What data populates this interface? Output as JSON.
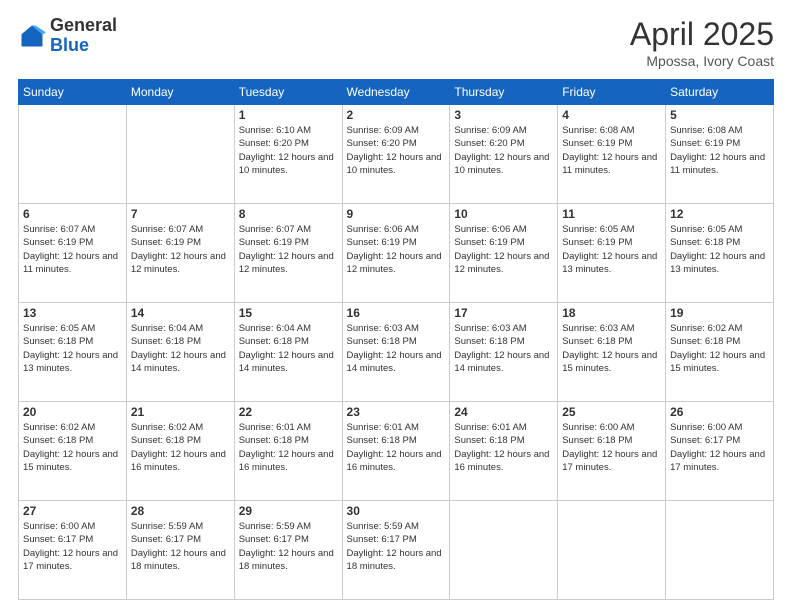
{
  "logo": {
    "general": "General",
    "blue": "Blue"
  },
  "title": {
    "month_year": "April 2025",
    "location": "Mpossa, Ivory Coast"
  },
  "weekdays": [
    "Sunday",
    "Monday",
    "Tuesday",
    "Wednesday",
    "Thursday",
    "Friday",
    "Saturday"
  ],
  "weeks": [
    [
      {
        "day": "",
        "info": ""
      },
      {
        "day": "",
        "info": ""
      },
      {
        "day": "1",
        "info": "Sunrise: 6:10 AM\nSunset: 6:20 PM\nDaylight: 12 hours and 10 minutes."
      },
      {
        "day": "2",
        "info": "Sunrise: 6:09 AM\nSunset: 6:20 PM\nDaylight: 12 hours and 10 minutes."
      },
      {
        "day": "3",
        "info": "Sunrise: 6:09 AM\nSunset: 6:20 PM\nDaylight: 12 hours and 10 minutes."
      },
      {
        "day": "4",
        "info": "Sunrise: 6:08 AM\nSunset: 6:19 PM\nDaylight: 12 hours and 11 minutes."
      },
      {
        "day": "5",
        "info": "Sunrise: 6:08 AM\nSunset: 6:19 PM\nDaylight: 12 hours and 11 minutes."
      }
    ],
    [
      {
        "day": "6",
        "info": "Sunrise: 6:07 AM\nSunset: 6:19 PM\nDaylight: 12 hours and 11 minutes."
      },
      {
        "day": "7",
        "info": "Sunrise: 6:07 AM\nSunset: 6:19 PM\nDaylight: 12 hours and 12 minutes."
      },
      {
        "day": "8",
        "info": "Sunrise: 6:07 AM\nSunset: 6:19 PM\nDaylight: 12 hours and 12 minutes."
      },
      {
        "day": "9",
        "info": "Sunrise: 6:06 AM\nSunset: 6:19 PM\nDaylight: 12 hours and 12 minutes."
      },
      {
        "day": "10",
        "info": "Sunrise: 6:06 AM\nSunset: 6:19 PM\nDaylight: 12 hours and 12 minutes."
      },
      {
        "day": "11",
        "info": "Sunrise: 6:05 AM\nSunset: 6:19 PM\nDaylight: 12 hours and 13 minutes."
      },
      {
        "day": "12",
        "info": "Sunrise: 6:05 AM\nSunset: 6:18 PM\nDaylight: 12 hours and 13 minutes."
      }
    ],
    [
      {
        "day": "13",
        "info": "Sunrise: 6:05 AM\nSunset: 6:18 PM\nDaylight: 12 hours and 13 minutes."
      },
      {
        "day": "14",
        "info": "Sunrise: 6:04 AM\nSunset: 6:18 PM\nDaylight: 12 hours and 14 minutes."
      },
      {
        "day": "15",
        "info": "Sunrise: 6:04 AM\nSunset: 6:18 PM\nDaylight: 12 hours and 14 minutes."
      },
      {
        "day": "16",
        "info": "Sunrise: 6:03 AM\nSunset: 6:18 PM\nDaylight: 12 hours and 14 minutes."
      },
      {
        "day": "17",
        "info": "Sunrise: 6:03 AM\nSunset: 6:18 PM\nDaylight: 12 hours and 14 minutes."
      },
      {
        "day": "18",
        "info": "Sunrise: 6:03 AM\nSunset: 6:18 PM\nDaylight: 12 hours and 15 minutes."
      },
      {
        "day": "19",
        "info": "Sunrise: 6:02 AM\nSunset: 6:18 PM\nDaylight: 12 hours and 15 minutes."
      }
    ],
    [
      {
        "day": "20",
        "info": "Sunrise: 6:02 AM\nSunset: 6:18 PM\nDaylight: 12 hours and 15 minutes."
      },
      {
        "day": "21",
        "info": "Sunrise: 6:02 AM\nSunset: 6:18 PM\nDaylight: 12 hours and 16 minutes."
      },
      {
        "day": "22",
        "info": "Sunrise: 6:01 AM\nSunset: 6:18 PM\nDaylight: 12 hours and 16 minutes."
      },
      {
        "day": "23",
        "info": "Sunrise: 6:01 AM\nSunset: 6:18 PM\nDaylight: 12 hours and 16 minutes."
      },
      {
        "day": "24",
        "info": "Sunrise: 6:01 AM\nSunset: 6:18 PM\nDaylight: 12 hours and 16 minutes."
      },
      {
        "day": "25",
        "info": "Sunrise: 6:00 AM\nSunset: 6:18 PM\nDaylight: 12 hours and 17 minutes."
      },
      {
        "day": "26",
        "info": "Sunrise: 6:00 AM\nSunset: 6:17 PM\nDaylight: 12 hours and 17 minutes."
      }
    ],
    [
      {
        "day": "27",
        "info": "Sunrise: 6:00 AM\nSunset: 6:17 PM\nDaylight: 12 hours and 17 minutes."
      },
      {
        "day": "28",
        "info": "Sunrise: 5:59 AM\nSunset: 6:17 PM\nDaylight: 12 hours and 18 minutes."
      },
      {
        "day": "29",
        "info": "Sunrise: 5:59 AM\nSunset: 6:17 PM\nDaylight: 12 hours and 18 minutes."
      },
      {
        "day": "30",
        "info": "Sunrise: 5:59 AM\nSunset: 6:17 PM\nDaylight: 12 hours and 18 minutes."
      },
      {
        "day": "",
        "info": ""
      },
      {
        "day": "",
        "info": ""
      },
      {
        "day": "",
        "info": ""
      }
    ]
  ]
}
